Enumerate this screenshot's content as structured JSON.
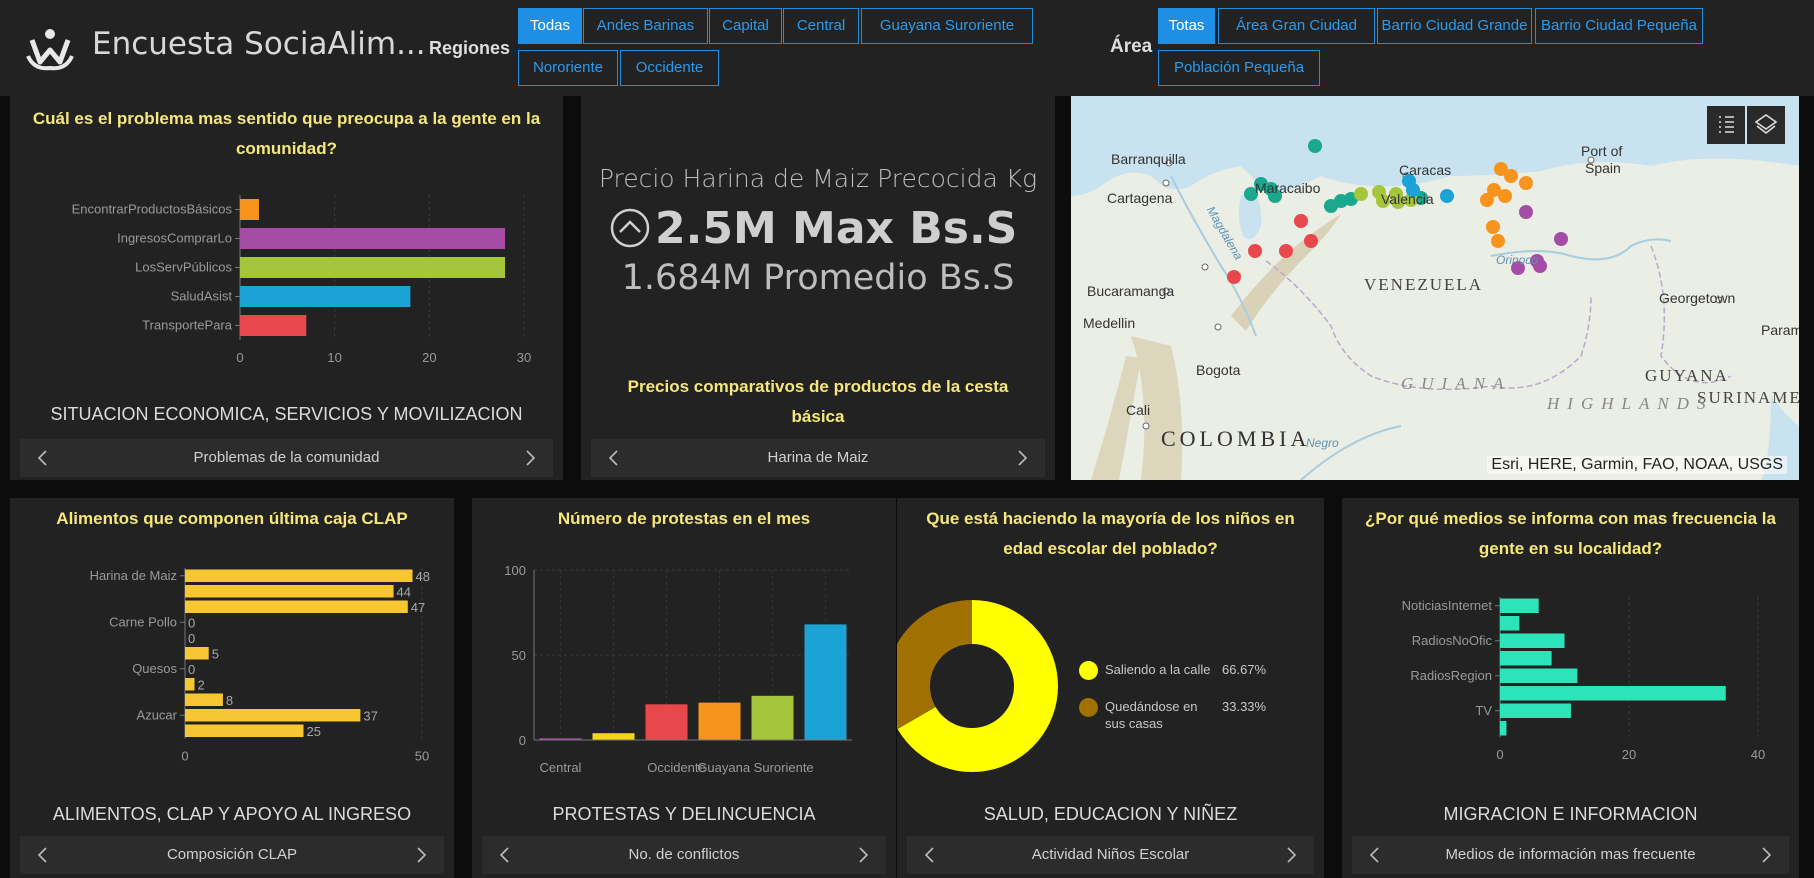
{
  "colors": {
    "accent": "#1f8fe6",
    "title_yellow": "#f5e77a",
    "panel_bg": "#222222",
    "page_bg": "#0c0c0c",
    "clap_bar": "#f7c633",
    "media_bar": "#2de3b8"
  },
  "header": {
    "app_title": "Encuesta SociaAlim...",
    "logo_icon": "people-hands-logo-icon",
    "regiones_label": "Regiones",
    "regiones": [
      "Todas",
      "Andes Barinas",
      "Capital",
      "Central",
      "Guayana Suroriente",
      "Nororiente",
      "Occidente"
    ],
    "regiones_selected": "Todas",
    "area_label": "Área",
    "areas": [
      "Totas",
      "Área Gran Ciudad",
      "Barrio Ciudad Grande",
      "Barrio Ciudad Pequeña",
      "Población Pequeña"
    ],
    "areas_selected": "Totas"
  },
  "panels": {
    "problems": {
      "title": "Cuál es el problema mas sentido que preocupa a la gente en la comunidad?",
      "section": "SITUACION ECONOMICA, SERVICIOS Y MOVILIZACION",
      "nav_label": "Problemas de la comunidad"
    },
    "indicator": {
      "title": "Precio Harina de Maiz Precocida Kg",
      "max_value": "2.5M Max Bs.S",
      "avg_value": "1.684M Promedio Bs.S",
      "section": "Precios comparativos de productos de la cesta básica",
      "nav_label": "Harina de Maiz",
      "icon": "chevron-up-circle-icon"
    },
    "map": {
      "attribution": "Esri, HERE, Garmin, FAO, NOAA, USGS",
      "legend_button_icon": "legend-list-icon",
      "layers_button_icon": "layers-icon",
      "labels": {
        "barranquilla": "Barranquilla",
        "cartagena": "Cartagena",
        "maracaibo": "Maracaibo",
        "caracas": "Caracas",
        "valencia": "Valencia",
        "port_of_spain_1": "Port of",
        "port_of_spain_2": "Spain",
        "venezuela": "VENEZUELA",
        "bucaramanga": "Bucaramanga",
        "medellin": "Medellin",
        "bogota": "Bogota",
        "cali": "Cali",
        "colombia": "COLOMBIA",
        "georgetown": "Georgetown",
        "param": "Param",
        "guyana": "GUYANA",
        "suriname": "SURINAME",
        "guiana": "GUIANA",
        "highlands": "HIGHLANDS",
        "orinoco": "Orinoco",
        "magdalena": "Magdalena",
        "negro": "Negro"
      }
    },
    "clap": {
      "title": "Alimentos que componen última caja CLAP",
      "section": "ALIMENTOS, CLAP Y APOYO AL INGRESO",
      "nav_label": "Composición CLAP"
    },
    "protests": {
      "title": "Número de protestas en el mes",
      "section": "PROTESTAS Y DELINCUENCIA",
      "nav_label": "No. de conflictos"
    },
    "children": {
      "title": "Que está haciendo la mayoría de los niños en edad escolar del poblado?",
      "section": "SALUD, EDUCACION Y NIÑEZ",
      "nav_label": "Actividad Niños Escolar"
    },
    "media": {
      "title": "¿Por qué medios se informa con mas frecuencia la gente en su localidad?",
      "section": "MIGRACION E INFORMACION",
      "nav_label": "Medios de información mas frecuente"
    }
  },
  "chart_data": [
    {
      "type": "bar",
      "orientation": "horizontal",
      "categories": [
        "EncontrarProductosBásicos",
        "IngresosComprarLo",
        "LosServPúblicos",
        "SaludAsist",
        "TransportePara"
      ],
      "values": [
        2,
        28,
        28,
        18,
        7
      ],
      "colors": [
        "#f7941d",
        "#a64ca6",
        "#a5c63b",
        "#1ba3d6",
        "#e8474c"
      ],
      "xlim": [
        0,
        30
      ],
      "xticks": [
        "0",
        "10",
        "20",
        "30"
      ],
      "grid": true
    },
    {
      "type": "bar",
      "orientation": "horizontal",
      "categories": [
        "Harina de Maiz",
        "",
        "",
        "Carne Pollo",
        "",
        "",
        "Quesos",
        "",
        "",
        "Azucar",
        ""
      ],
      "values": [
        48,
        44,
        47,
        0,
        0,
        5,
        0,
        2,
        8,
        37,
        25
      ],
      "data_labels": [
        "48",
        "44",
        "47",
        "0",
        "0",
        "5",
        "0",
        "2",
        "8",
        "37",
        "25"
      ],
      "xlim": [
        0,
        50
      ],
      "xticks": [
        "0",
        "50"
      ],
      "grid": true
    },
    {
      "type": "bar",
      "categories": [
        "Central",
        "",
        "Occidente",
        "Guayana Suroriente",
        "",
        ""
      ],
      "values": [
        1,
        4,
        21,
        22,
        26,
        68
      ],
      "colors": [
        "#a64ca6",
        "#f7d516",
        "#e8474c",
        "#f7941d",
        "#a5c63b",
        "#1ba3d6"
      ],
      "ylim": [
        0,
        100
      ],
      "yticks": [
        "0",
        "50",
        "100"
      ],
      "grid": true
    },
    {
      "type": "pie",
      "donut": true,
      "slices": [
        {
          "label": "Saliendo a la calle",
          "percent_label": "66.67%",
          "value": 66.67,
          "color": "#ffff00"
        },
        {
          "label": "Quedándose en sus casas",
          "percent_label": "33.33%",
          "value": 33.33,
          "color": "#a07000"
        }
      ],
      "legend_lines": [
        [
          "Saliendo a la calle",
          "66.67%"
        ],
        [
          "Quedándose en",
          "33.33%",
          "sus casas"
        ]
      ]
    },
    {
      "type": "bar",
      "orientation": "horizontal",
      "categories": [
        "NoticiasInternet",
        "",
        "RadiosNoOfic",
        "",
        "RadiosRegion",
        "",
        "TV",
        ""
      ],
      "values": [
        6,
        3,
        10,
        8,
        12,
        35,
        11,
        1
      ],
      "xlim": [
        0,
        40
      ],
      "xticks": [
        "0",
        "20",
        "40"
      ],
      "grid": true
    }
  ]
}
